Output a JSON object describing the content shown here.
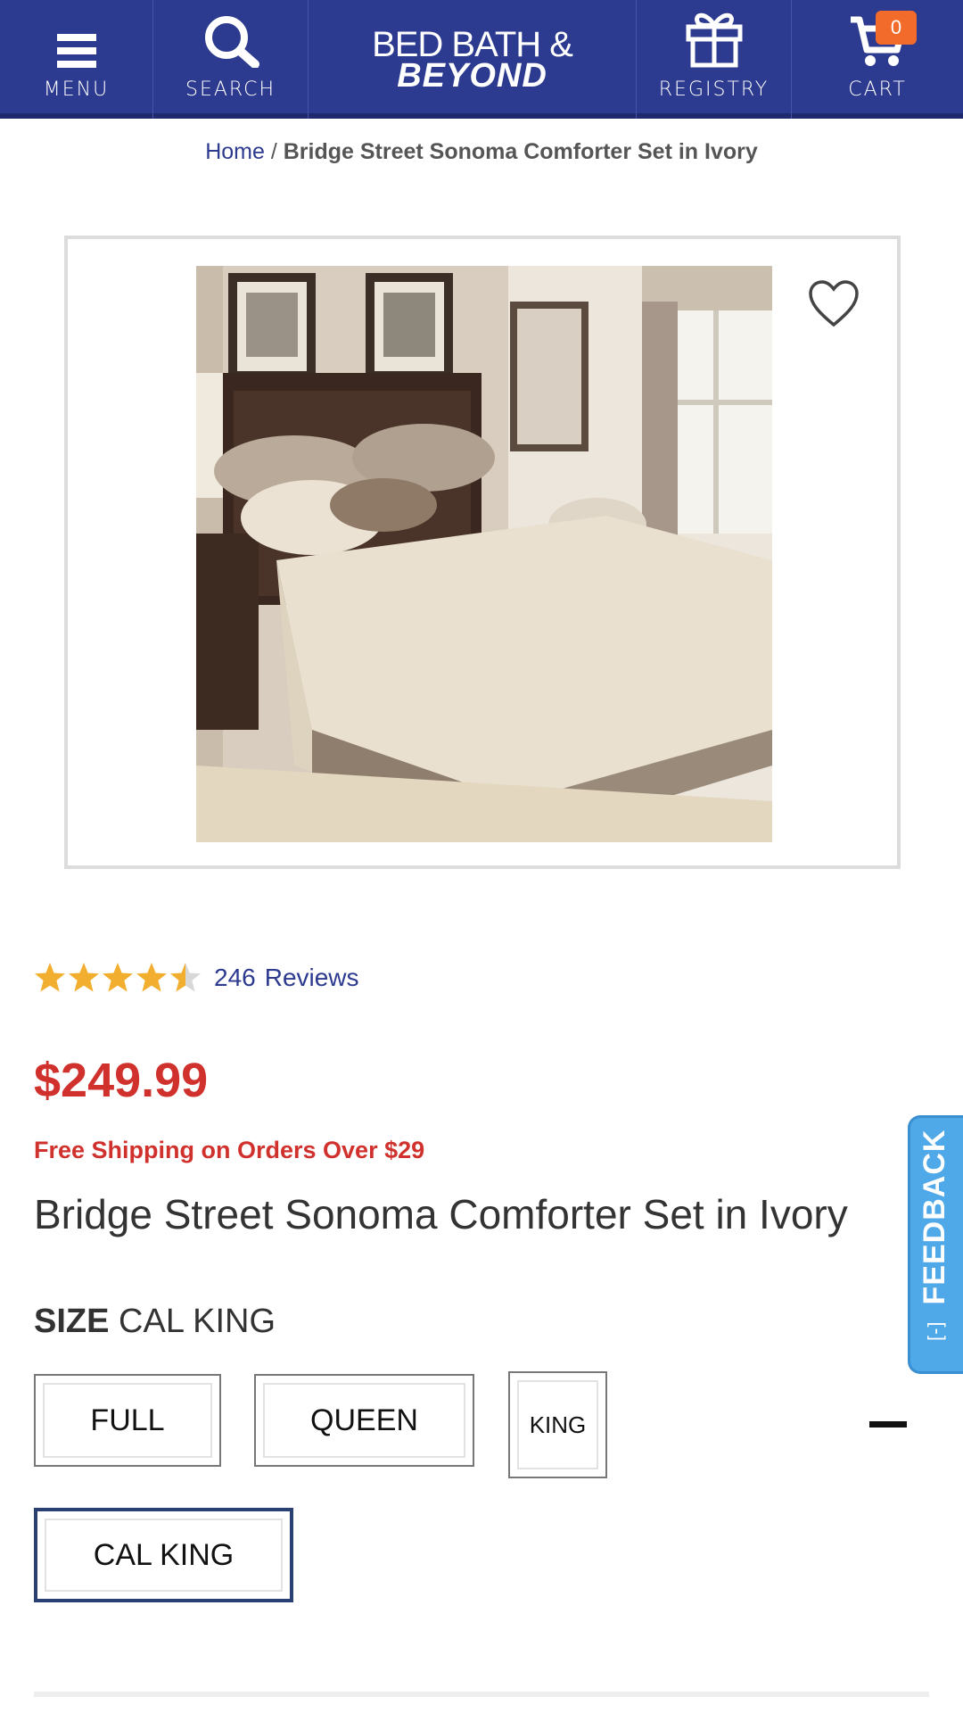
{
  "header": {
    "menu_label": "MENU",
    "search_label": "SEARCH",
    "logo_line1": "BED BATH &",
    "logo_line2": "BEYOND",
    "registry_label": "REGISTRY",
    "cart_label": "CART",
    "cart_count": "0"
  },
  "breadcrumb": {
    "home": "Home",
    "separator": " / ",
    "current": "Bridge Street Sonoma Comforter Set in Ivory"
  },
  "product": {
    "image_alt": "Bridge Street Sonoma Comforter Set in Ivory",
    "rating": 4.5,
    "rating_max": 5,
    "review_count": "246",
    "review_word": "Reviews",
    "price": "$249.99",
    "shipping": "Free Shipping on Orders Over $29",
    "title": "Bridge Street Sonoma Comforter Set in Ivory"
  },
  "size": {
    "label": "SIZE",
    "selected": "CAL KING",
    "options": [
      "FULL",
      "QUEEN",
      "KING",
      "CAL KING"
    ]
  },
  "feedback": {
    "label": "FEEDBACK",
    "icon": "[-]"
  },
  "colors": {
    "header_bg": "#2c3a8f",
    "price_red": "#d0312d",
    "link_blue": "#2c3a8f",
    "star_gold": "#f2ae2e",
    "cart_badge": "#f26b2a",
    "feedback_blue": "#4fa8e8",
    "selected_border": "#2b4072"
  }
}
